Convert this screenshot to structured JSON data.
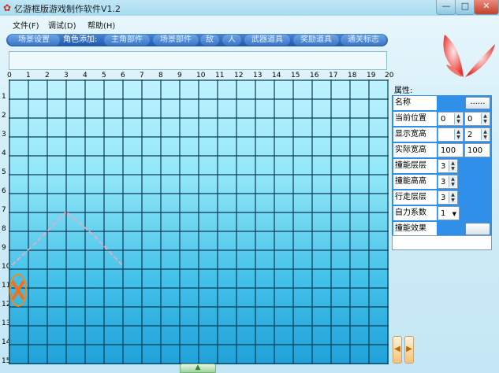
{
  "window": {
    "title": "亿游框版游戏制作软件V1.2",
    "min_label": "—",
    "max_label": "□",
    "close_label": "✕",
    "icon": "app-logo-icon"
  },
  "menu": {
    "items": [
      "文件(F)",
      "调试(D)",
      "帮助(H)"
    ]
  },
  "toolbar": {
    "scene_button": "场景设置",
    "role_label": "角色添加:",
    "items": [
      "主角部件",
      "场景部件",
      "敌",
      "人",
      "武器道具",
      "奖励道具",
      "通关标志"
    ]
  },
  "grid": {
    "columns": 20,
    "rows": 15,
    "col_ticks": [
      "0",
      "1",
      "2",
      "3",
      "4",
      "5",
      "6",
      "7",
      "8",
      "9",
      "10",
      "11",
      "12",
      "13",
      "14",
      "15",
      "16",
      "17",
      "18",
      "19",
      "20"
    ],
    "row_ticks": [
      "1",
      "2",
      "3",
      "4",
      "5",
      "6",
      "7",
      "8",
      "9",
      "10",
      "11",
      "12",
      "13",
      "14",
      "15"
    ],
    "sprite_icon": "orange-x-sprite-icon",
    "path_color": "#f2a6c4",
    "line_color": "#0c3a55",
    "scroll_label": "▲"
  },
  "properties": {
    "title": "属性:",
    "name_label": "名称",
    "name_button": "......",
    "position": {
      "label": "当前位置",
      "x": "0",
      "y": "0"
    },
    "display_size": {
      "label": "显示宽高",
      "w": "",
      "h": "2"
    },
    "real_size": {
      "label": "实际宽高",
      "w": "100",
      "h": "100"
    },
    "collision_layer": {
      "label": "撞能层层",
      "value": "3"
    },
    "collision_height": {
      "label": "撞能高高",
      "value": "3"
    },
    "walk_layer": {
      "label": "行走层层",
      "value": "3"
    },
    "gravity": {
      "label": "自力系数",
      "value": "1"
    },
    "skill_effect": {
      "label": "撞能效果"
    }
  },
  "nav": {
    "prev": "◀",
    "next": "▶"
  }
}
